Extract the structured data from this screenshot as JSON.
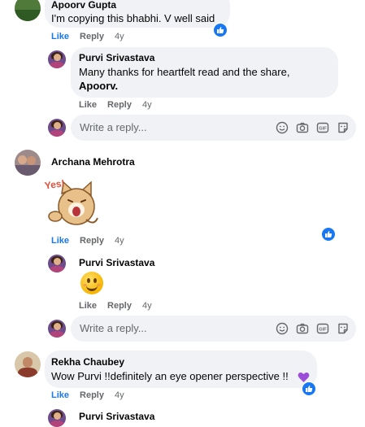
{
  "comments": [
    {
      "author": "Apoorv Gupta",
      "text": "I'm copying this bhabhi. V well said",
      "like": "Like",
      "reply": "Reply",
      "time": "4y",
      "reply_item": {
        "author": "Purvi Srivastava",
        "text": "Many thanks for heartfelt read and the share,",
        "tag": "Apoorv.",
        "like": "Like",
        "reply": "Reply",
        "time": "4y"
      }
    },
    {
      "author": "Archana Mehrotra",
      "sticker_label": "Yes!",
      "like": "Like",
      "reply": "Reply",
      "time": "4y",
      "reply_item": {
        "author": "Purvi Srivastava",
        "like": "Like",
        "reply": "Reply",
        "time": "4y"
      }
    },
    {
      "author": "Rekha Chaubey",
      "text": "Wow Purvi !!definitely an eye opener perspective !!",
      "like": "Like",
      "reply": "Reply",
      "time": "4y",
      "reply_item": {
        "author": "Purvi Srivastava"
      }
    }
  ],
  "reply_box": {
    "placeholder": "Write a reply..."
  },
  "icons": [
    "emoji-icon",
    "camera-icon",
    "gif-icon",
    "sticker-icon",
    "like-reaction-icon",
    "purple-heart-icon"
  ],
  "colors": {
    "like_blue": "#1877f2",
    "bubble_bg": "#f0f2f5",
    "meta_gray": "#65676b"
  }
}
